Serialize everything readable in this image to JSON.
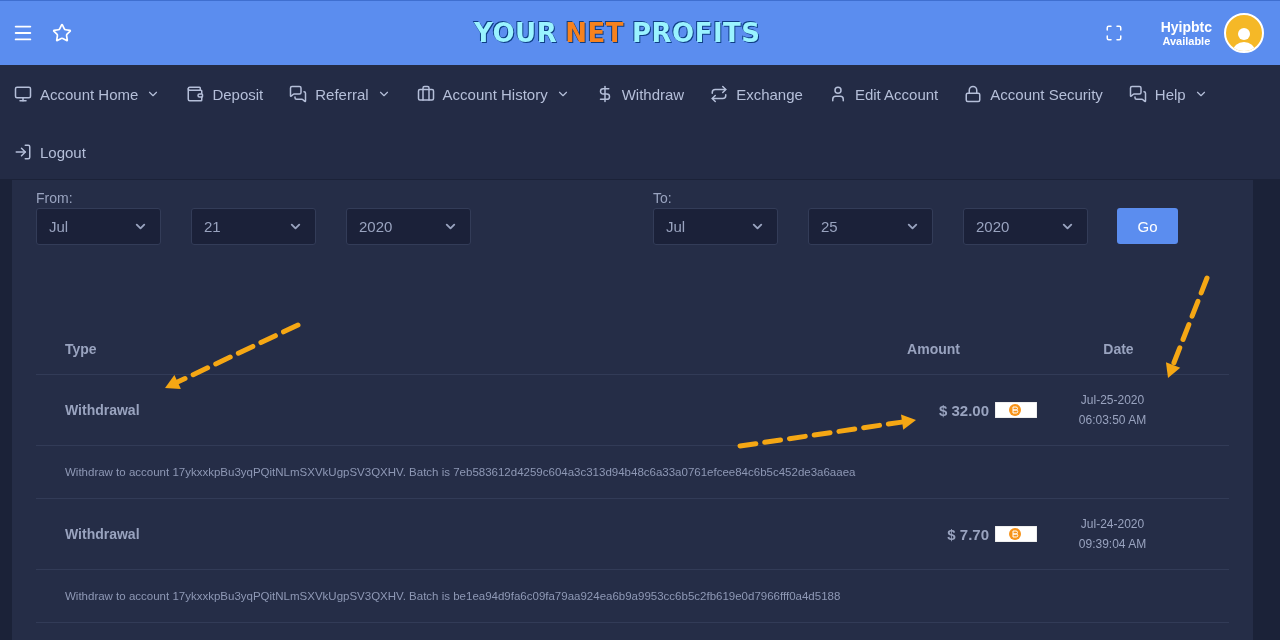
{
  "header": {
    "logo": [
      {
        "text": "YOUR",
        "color": "#9af3ff"
      },
      {
        "text": "NET",
        "color": "#f7821e"
      },
      {
        "text": "PROFITS",
        "color": "#9af3ff"
      }
    ],
    "user": {
      "name": "Hyipbtc",
      "status": "Available"
    }
  },
  "nav": [
    {
      "label": "Account Home",
      "has_menu": true
    },
    {
      "label": "Deposit",
      "has_menu": false
    },
    {
      "label": "Referral",
      "has_menu": true
    },
    {
      "label": "Account History",
      "has_menu": true
    },
    {
      "label": "Withdraw",
      "has_menu": false
    },
    {
      "label": "Exchange",
      "has_menu": false
    },
    {
      "label": "Edit Account",
      "has_menu": false
    },
    {
      "label": "Account Security",
      "has_menu": false
    },
    {
      "label": "Help",
      "has_menu": true
    },
    {
      "label": "Logout",
      "has_menu": false
    }
  ],
  "filter": {
    "from": {
      "label": "From:",
      "month": "Jul",
      "day": "21",
      "year": "2020"
    },
    "to": {
      "label": "To:",
      "month": "Jul",
      "day": "25",
      "year": "2020"
    },
    "button": "Go"
  },
  "table": {
    "columns": [
      "Type",
      "Amount",
      "Date"
    ],
    "rows": [
      {
        "type": "Withdrawal",
        "amount": "$ 32.00",
        "date": "Jul-25-2020",
        "time": "06:03:50 AM",
        "detail": "Withdraw to account 17ykxxkpBu3yqPQitNLmSXVkUgpSV3QXHV. Batch is 7eb583612d4259c604a3c313d94b48c6a33a0761efcee84c6b5c452de3a6aaea"
      },
      {
        "type": "Withdrawal",
        "amount": "$ 7.70",
        "date": "Jul-24-2020",
        "time": "09:39:04 AM",
        "detail": "Withdraw to account 17ykxxkpBu3yqPQitNLmSXVkUgpSV3QXHV. Batch is be1ea94d9fa6c09fa79aa924ea6b9a9953cc6b5c2fb619e0d7966fff0a4d5188"
      }
    ]
  }
}
